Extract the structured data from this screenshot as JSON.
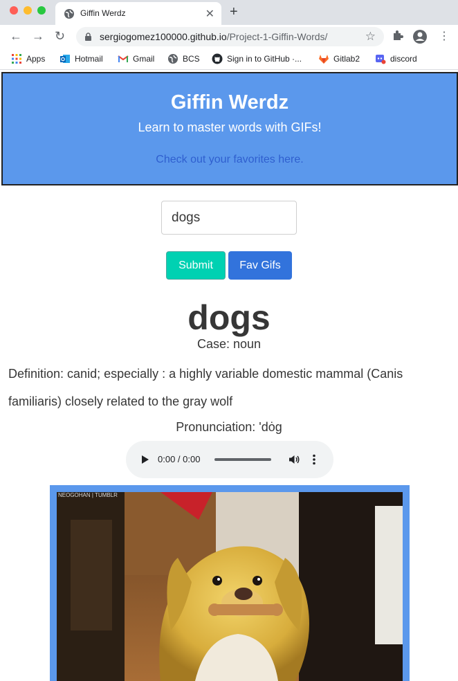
{
  "browser": {
    "tab_title": "Giffin Werdz",
    "url_host": "sergiogomez100000.github.io",
    "url_path": "/Project-1-Giffin-Words/",
    "bookmarks": [
      {
        "label": "Apps",
        "icon": "apps-grid-icon"
      },
      {
        "label": "Hotmail",
        "icon": "outlook-icon"
      },
      {
        "label": "Gmail",
        "icon": "gmail-icon"
      },
      {
        "label": "BCS",
        "icon": "globe-icon"
      },
      {
        "label": "Sign in to GitHub ·...",
        "icon": "github-icon"
      },
      {
        "label": "Gitlab2",
        "icon": "gitlab-icon"
      },
      {
        "label": "discord",
        "icon": "discord-icon"
      }
    ]
  },
  "header": {
    "title": "Giffin Werdz",
    "subtitle": "Learn to master words with GIFs!",
    "favorites_link": "Check out your favorites here."
  },
  "search": {
    "value": "dogs"
  },
  "buttons": {
    "submit": "Submit",
    "fav": "Fav Gifs"
  },
  "result": {
    "word": "dogs",
    "case": "Case: noun",
    "definition": "Definition: canid; especially : a highly variable domestic mammal (Canis familiaris) closely related to the gray wolf",
    "pronunciation": "Pronunciation: 'dȯg"
  },
  "audio": {
    "time": "0:00 / 0:00"
  },
  "gif": {
    "watermark": "NEOGOHAN | TUMBLR"
  },
  "colors": {
    "hero": "#5b98ec",
    "submit": "#00d1b2",
    "fav": "#3273dc"
  }
}
